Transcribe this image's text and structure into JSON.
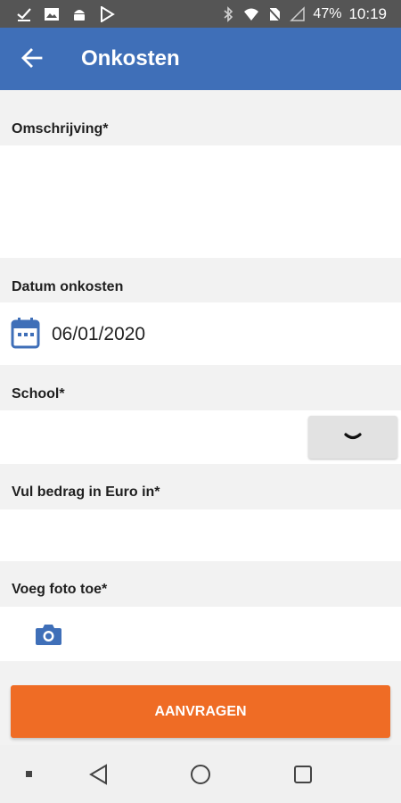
{
  "status_bar": {
    "battery": "47%",
    "time": "10:19",
    "left_icons": [
      "download-done-icon",
      "image-icon",
      "android-icon",
      "play-store-icon"
    ],
    "right_icons": [
      "bluetooth-icon",
      "wifi-icon",
      "no-sim-icon",
      "signal-icon"
    ]
  },
  "app_bar": {
    "title": "Onkosten",
    "back_icon": "arrow-left-icon",
    "color": "#3f6fb8"
  },
  "form": {
    "description": {
      "label": "Omschrijving*",
      "value": ""
    },
    "date": {
      "label": "Datum onkosten",
      "value": "06/01/2020",
      "icon": "calendar-icon"
    },
    "school": {
      "label": "School*",
      "value": "",
      "dropdown_icon": "chevron-down-icon"
    },
    "amount": {
      "label": "Vul bedrag in Euro in*",
      "value": ""
    },
    "photo": {
      "label": "Voeg foto toe*",
      "icon": "camera-icon"
    }
  },
  "actions": {
    "submit_label": "AANVRAGEN",
    "submit_color": "#ef6c25"
  },
  "nav_bar": {
    "items": [
      "recent-dot-icon",
      "back-triangle-icon",
      "home-circle-icon",
      "overview-square-icon"
    ]
  }
}
